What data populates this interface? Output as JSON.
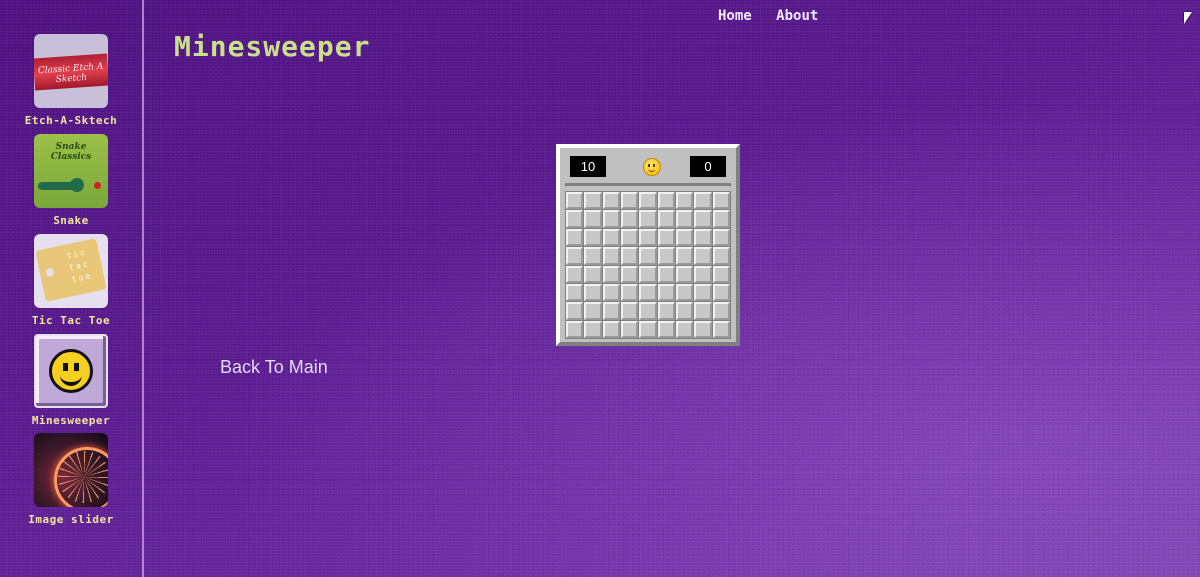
{
  "sidebar": {
    "items": [
      {
        "label": "Etch-A-Sktech",
        "thumb_text": "Classic Etch A Sketch"
      },
      {
        "label": "Snake",
        "thumb_text": "Snake Classics"
      },
      {
        "label": "Tic Tac Toe",
        "thumb_text": "tic tac toe"
      },
      {
        "label": "Minesweeper"
      },
      {
        "label": "Image slider"
      }
    ]
  },
  "nav": {
    "home": "Home",
    "about": "About"
  },
  "page": {
    "title": "Minesweeper",
    "back_link": "Back To Main"
  },
  "game": {
    "mines_remaining": "10",
    "timer": "0",
    "rows": 8,
    "cols": 9
  },
  "colors": {
    "title": "#c8e08a",
    "sidebar_label": "#f0e6a0",
    "background": "#5a1a8f"
  }
}
